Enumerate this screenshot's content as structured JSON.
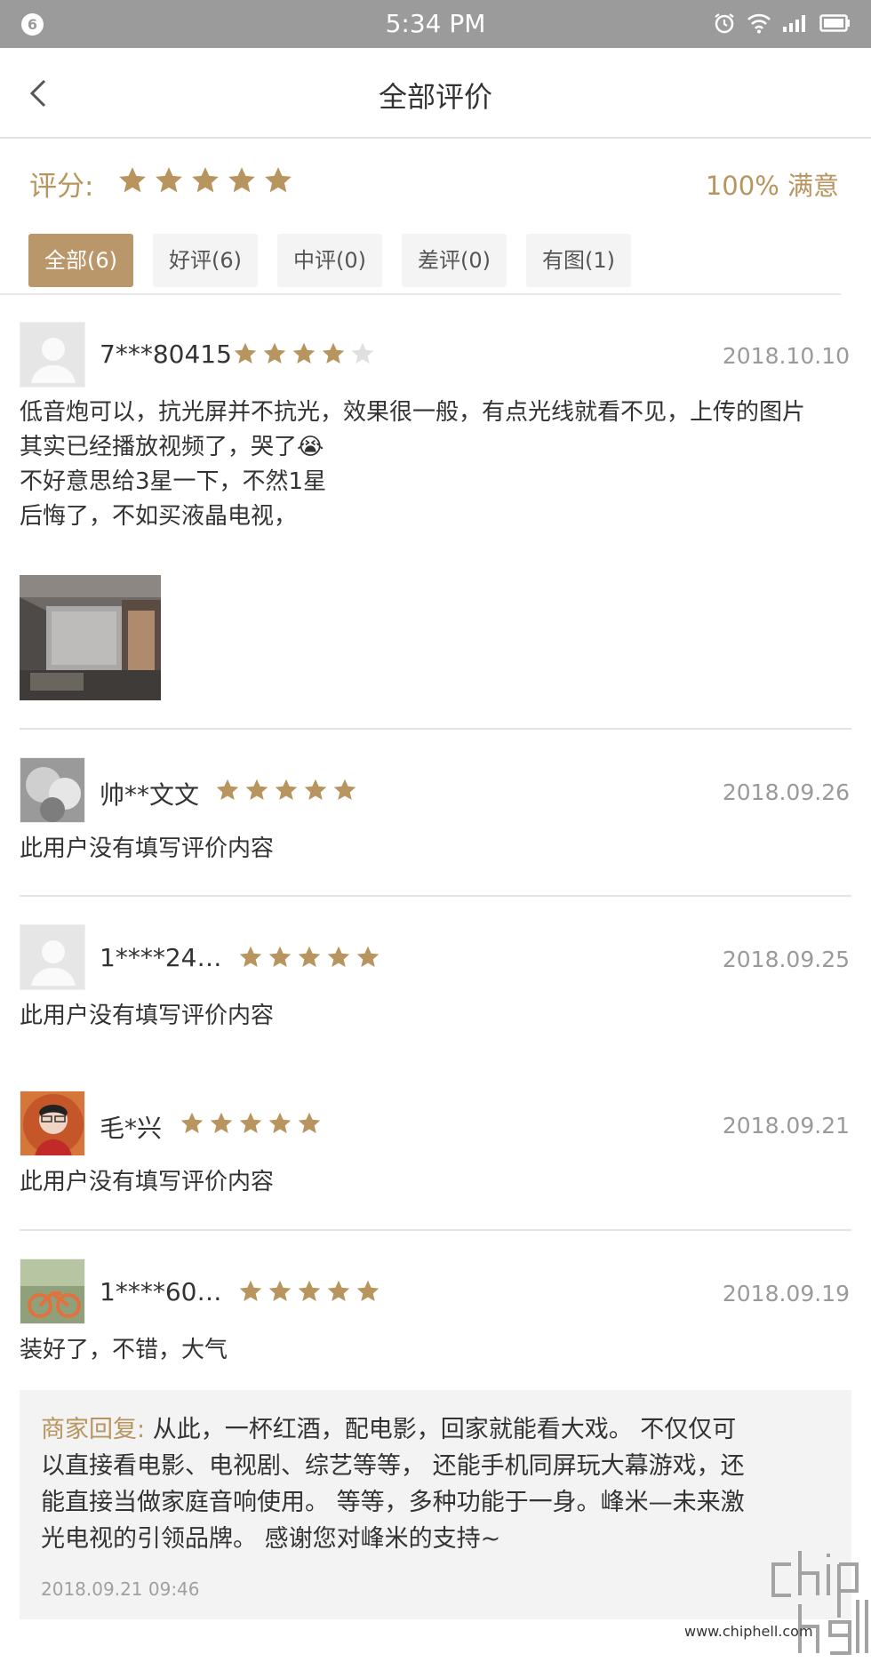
{
  "status_bar": {
    "notification_count": "6",
    "time": "5:34 PM"
  },
  "header": {
    "title": "全部评价"
  },
  "summary": {
    "score_label": "评分:",
    "rating": 5,
    "satisfaction": "100% 满意"
  },
  "filters": [
    {
      "label": "全部(6)",
      "active": true
    },
    {
      "label": "好评(6)",
      "active": false
    },
    {
      "label": "中评(0)",
      "active": false
    },
    {
      "label": "差评(0)",
      "active": false
    },
    {
      "label": "有图(1)",
      "active": false
    }
  ],
  "reviews": [
    {
      "user": "7***80415",
      "rating": 4,
      "date": "2018.10.10",
      "lines": [
        "低音炮可以，抗光屏并不抗光，效果很一般，有点光线就看不见，上传的图片",
        "其实已经播放视频了，哭了😭",
        "不好意思给3星一下，不然1星",
        "后悔了，不如买液晶电视，"
      ]
    },
    {
      "user": "帅**文文",
      "rating": 5,
      "date": "2018.09.26",
      "text": "此用户没有填写评价内容"
    },
    {
      "user": "1****24…",
      "rating": 5,
      "date": "2018.09.25",
      "text": "此用户没有填写评价内容"
    },
    {
      "user": "毛*兴",
      "rating": 5,
      "date": "2018.09.21",
      "text": "此用户没有填写评价内容"
    },
    {
      "user": "1****60…",
      "rating": 5,
      "date": "2018.09.19",
      "text": "装好了，不错，大气"
    }
  ],
  "merchant_reply": {
    "label": "商家回复:",
    "line1": " 从此，一杯红酒，配电影，回家就能看大戏。 不仅仅可",
    "line2": "以直接看电影、电视剧、综艺等等， 还能手机同屏玩大幕游戏，还",
    "line3": "能直接当做家庭音响使用。 等等，多种功能于一身。峰米—未来激",
    "line4": "光电视的引领品牌。 感谢您对峰米的支持~",
    "time": "2018.09.21 09:46"
  },
  "watermark": {
    "url": "www.chiphell.com"
  },
  "colors": {
    "gold": "#b8955f",
    "star_empty": "#e0e0e0",
    "status_bar": "#9b9b9b"
  }
}
